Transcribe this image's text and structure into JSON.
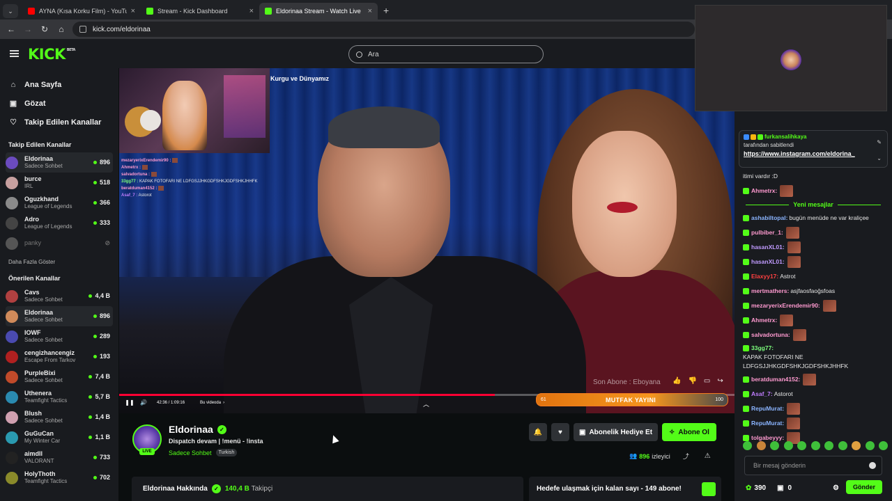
{
  "browser": {
    "tabs": [
      {
        "label": "AYNA (Kısa Korku Film) - YouTube",
        "color": "#ff0000"
      },
      {
        "label": "Stream - Kick Dashboard",
        "color": "#53fc18"
      },
      {
        "label": "Eldorinaa Stream - Watch Live",
        "color": "#53fc18"
      }
    ],
    "url": "kick.com/eldorinaa"
  },
  "header": {
    "logo": "KICK",
    "logo_sup": "BETA",
    "search_placeholder": "Ara"
  },
  "sidebar": {
    "nav": [
      {
        "label": "Ana Sayfa",
        "icon": "home-icon"
      },
      {
        "label": "Gözat",
        "icon": "browse-icon"
      },
      {
        "label": "Takip Edilen Kanallar",
        "icon": "heart-icon"
      }
    ],
    "followed_title": "Takip Edilen Kanallar",
    "followed": [
      {
        "name": "Eldorinaa",
        "cat": "Sadece Sohbet",
        "viewers": "896",
        "color": "#6b4bbf"
      },
      {
        "name": "burce",
        "cat": "IRL",
        "viewers": "518",
        "color": "#c7a0a0"
      },
      {
        "name": "Oguzkhand",
        "cat": "League of Legends",
        "viewers": "366",
        "color": "#8a8a8a"
      },
      {
        "name": "Adro",
        "cat": "League of Legends",
        "viewers": "333",
        "color": "#444"
      },
      {
        "name": "panky",
        "cat": "",
        "viewers": "",
        "color": "#555"
      }
    ],
    "more_label": "Daha Fazla Göster",
    "recommended_title": "Önerilen Kanallar",
    "recommended": [
      {
        "name": "Cavs",
        "cat": "Sadece Sohbet",
        "viewers": "4,4 B",
        "color": "#b04040"
      },
      {
        "name": "Eldorinaa",
        "cat": "Sadece Sohbet",
        "viewers": "896",
        "color": "#d08a5a"
      },
      {
        "name": "IOWF",
        "cat": "Sadece Sohbet",
        "viewers": "289",
        "color": "#4a4ab0"
      },
      {
        "name": "cengizhancengiz",
        "cat": "Escape From Tarkov",
        "viewers": "193",
        "color": "#b02020"
      },
      {
        "name": "PurpleBixi",
        "cat": "Sadece Sohbet",
        "viewers": "7,4 B",
        "color": "#c04a2a"
      },
      {
        "name": "Uthenera",
        "cat": "Teamfight Tactics",
        "viewers": "5,7 B",
        "color": "#2a8ab0"
      },
      {
        "name": "Blush",
        "cat": "Sadece Sohbet",
        "viewers": "1,4 B",
        "color": "#d0a0b0"
      },
      {
        "name": "GuGuCan",
        "cat": "My Winter Car",
        "viewers": "1,1 B",
        "color": "#2a9ab0"
      },
      {
        "name": "aimdll",
        "cat": "VALORANT",
        "viewers": "733",
        "color": "#222"
      },
      {
        "name": "HolyThoth",
        "cat": "Teamfight Tactics",
        "viewers": "702",
        "color": "#8a8a2a"
      }
    ]
  },
  "video": {
    "pip_title": "Kurgu ve Dünyamız",
    "overlay_chat": [
      {
        "u": "mezaryerixErendemir90 :",
        "t": "",
        "c": "#ff9ad0",
        "emo": true
      },
      {
        "u": "Ahmetrx :",
        "t": "",
        "c": "#ff9ad0",
        "emo": true
      },
      {
        "u": "salvadortuna :",
        "t": "",
        "c": "#ff9ad0",
        "emo": true
      },
      {
        "u": "33gg77 :",
        "t": "KAPAK FOTOFARI NE LDFGSJJHKGDFSHKJGDFSHKJHHFK",
        "c": "#7dff7d",
        "emo": false
      },
      {
        "u": "beratduman4152 :",
        "t": "",
        "c": "#ff9ad0",
        "emo": true
      },
      {
        "u": "Asaf_7 :",
        "t": "Astorot",
        "c": "#c07dff",
        "emo": false
      }
    ],
    "sub_alert": "Son Abone : Eboyana",
    "time": "42:36 / 1:09:16",
    "chapter": "Bu videoda",
    "progress": 0.61,
    "goal": {
      "left": "61",
      "center": "MUTFAK YAYINI",
      "right": "100"
    }
  },
  "stream": {
    "name": "Eldorinaa",
    "live": "LIVE",
    "title": "Dispatch devam | !menü - !insta",
    "category": "Sadece Sohbet",
    "tag": "Turkish",
    "gift_label": "Abonelik Hediye Et",
    "sub_label": "Abone Ol",
    "viewers": "896",
    "viewers_label": "izleyici",
    "about": "Eldorinaa Hakkında",
    "followers": "140,4 B",
    "followers_label": "Takipçi",
    "goal_text": "Hedefe ulaşmak için kalan sayı - 149 abone!"
  },
  "chat": {
    "pinned_user": "furkansalihkaya",
    "pinned_by": "tarafından sabitlendi",
    "pinned_link": "https://www.instagram.com/eldorina_",
    "pre": [
      {
        "u": "",
        "t": "itimi vardır :D",
        "c": "#ddd",
        "emo": false
      },
      {
        "u": "Ahmetrx:",
        "t": "",
        "c": "#ff9ad0",
        "emo": true
      }
    ],
    "new_label": "Yeni mesajlar",
    "messages": [
      {
        "u": "ashabiltopal:",
        "t": "bugün menüde ne var kraliçee",
        "c": "#8ab4ff",
        "emo": false
      },
      {
        "u": "pulbiber_1:",
        "t": "",
        "c": "#ff9ad0",
        "emo": true
      },
      {
        "u": "hasanXL01:",
        "t": "",
        "c": "#c09aff",
        "emo": true
      },
      {
        "u": "hasanXL01:",
        "t": "",
        "c": "#c09aff",
        "emo": true
      },
      {
        "u": "Elaxyy17:",
        "t": "Astrot",
        "c": "#ff4040",
        "emo": false
      },
      {
        "u": "mertmathers:",
        "t": "asjfaosfaoğsfoas",
        "c": "#ff9ad0",
        "emo": false
      },
      {
        "u": "mezaryerixErendemir90:",
        "t": "",
        "c": "#ff9ad0",
        "emo": true
      },
      {
        "u": "Ahmetrx:",
        "t": "",
        "c": "#ff9ad0",
        "emo": true
      },
      {
        "u": "salvadortuna:",
        "t": "",
        "c": "#ff9ad0",
        "emo": true
      },
      {
        "u": "33gg77:",
        "t": "KAPAK FOTOFARI NE LDFGSJJHKGDFSHKJGDFSHKJHHFK",
        "c": "#7dff7d",
        "emo": false
      },
      {
        "u": "beratduman4152:",
        "t": "",
        "c": "#ff9ad0",
        "emo": true
      },
      {
        "u": "Asaf_7:",
        "t": "Astorot",
        "c": "#c07dff",
        "emo": false
      },
      {
        "u": "RepuMurat:",
        "t": "",
        "c": "#8ab4ff",
        "emo": true
      },
      {
        "u": "RepuMurat:",
        "t": "",
        "c": "#8ab4ff",
        "emo": true
      },
      {
        "u": "tolgabeyyy:",
        "t": "",
        "c": "#ff9ad0",
        "emo": true
      }
    ],
    "input_placeholder": "Bir mesaj gönderin",
    "points": "390",
    "gifts": "0",
    "send_label": "Gönder"
  },
  "colors": {
    "accent": "#53fc18",
    "bg": "#0b0e0f",
    "panel": "#191b1f"
  }
}
